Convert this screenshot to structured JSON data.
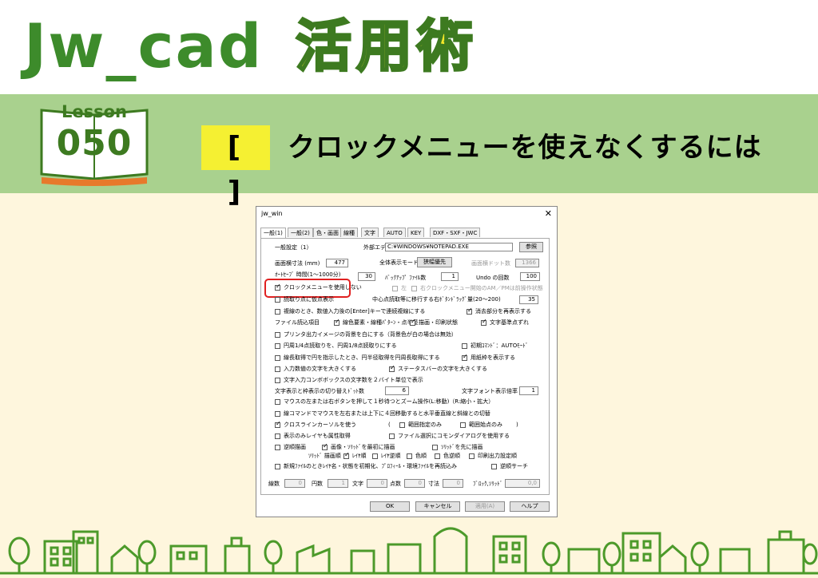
{
  "header": {
    "logo_latin": "Jw_cad",
    "logo_kanji": "活用術"
  },
  "lesson": {
    "label": "Lesson",
    "number": "050",
    "bracket": "[ ]",
    "title": "クロックメニューを使えなくするには"
  },
  "dialog": {
    "title": "jw_win",
    "close": "✕",
    "tabs": [
      "一般(1)",
      "一般(2)",
      "色・画面",
      "線種",
      "文字",
      "AUTO",
      "KEY",
      "DXF・SXF・JWC"
    ],
    "section": "一般設定（1）",
    "ext_editor_label": "外部エディタ",
    "ext_editor_value": "C:¥WINDOWS¥NOTEPAD.EXE",
    "browse": "参照",
    "screen_width_label": "画面横寸法 (mm)",
    "screen_width": "477",
    "full_display_label": "全体表示モード",
    "full_display_btn": "狭幅優先",
    "screen_dots_label": "画面横ドット数",
    "screen_dots": "1366",
    "autosave_label": "ｵｰﾄｾｰﾌﾞ 時間(1～1000分)",
    "autosave": "30",
    "backup_label": "ﾊﾞｯｸｱｯﾌﾟ ﾌｧｲﾙ数",
    "backup": "1",
    "undo_label": "Undo の回数",
    "undo": "100",
    "clock_label": "クロックメニューを使用しない",
    "left_label": "左",
    "right_clock_label": "右クロックメニュー開始のAM／PMは前操作状態",
    "read_point_label": "読取り点に仮点表示",
    "center_label": "中心点読取等に移行する右ﾎﾞﾀﾝﾄﾞﾗｯｸﾞ量(20～200)",
    "center_value": "35",
    "opt1": "複線のとき、数値入力後の[Enter]キーで連続複線にする",
    "opt1r": "消去部分を再表示する",
    "file_read_label": "ファイル読込項目",
    "file_read_a": "線色要素・線種ﾊﾟﾀｰﾝ・点半径",
    "file_read_b": "描画・印刷状態",
    "file_read_c": "文字基準点ずれ",
    "opt2": "プリンタ出力イメージの背景を白にする（背景色が白の場合は無効）",
    "opt3": "円周1/4点読取りを、円周1/8点読取りにする",
    "opt3r": "初期ｺﾏﾝﾄﾞ：AUTOﾓｰﾄﾞ",
    "opt4": "線長取得で円を指示したとき、円半径取得を円周長取得にする",
    "opt4r": "用紙枠を表示する",
    "opt5": "入力数値の文字を大きくする",
    "opt5r": "ステータスバーの文字を大きくする",
    "opt6": "文字入力コンボボックスの文字数を２バイト単位で表示",
    "text_dots_label": "文字表示と枠表示の切り替えﾄﾞｯﾄ数",
    "text_dots": "6",
    "text_font_label": "文字フォント表示倍率",
    "text_font": "1",
    "opt7": "マウスの左または右ボタンを押して１秒待つとズーム操作(L:移動)（R:縮小・拡大）",
    "opt8": "線コマンドでマウスを左右または上下に４回移動すると水平垂直線と斜線との切替",
    "opt9": "クロスラインカーソルを使う",
    "opt9a": "範囲指定のみ",
    "opt9b": "範囲始点のみ",
    "paren_open": "(",
    "paren_close": ")",
    "opt10": "表示のみレイヤも属性取得",
    "opt10r": "ファイル選択にコモンダイアログを使用する",
    "opt11": "逆順描画",
    "opt11a": "画像・ｿﾘｯﾄﾞを最初に描画",
    "opt11b": "ｿﾘｯﾄﾞを先に描画",
    "solid_label": "ｿﾘｯﾄﾞ 描画順",
    "layer_order": "ﾚｲﾔ順",
    "layer_rev": "ﾚｲﾔ逆順",
    "color_order": "色順",
    "color_rev": "色逆順",
    "print_order": "印刷出力設定順",
    "opt12": "新規ﾌｧｲﾙのときﾚｲﾔ名・状態を初期化、ﾌﾟﾛﾌｨｰﾙ・環境ﾌｧｲﾙを再読込み",
    "opt12r": "逆順サーチ",
    "counts": [
      {
        "label": "線数",
        "value": "0"
      },
      {
        "label": "円数",
        "value": "1"
      },
      {
        "label": "文字",
        "value": "0"
      },
      {
        "label": "点数",
        "value": "0"
      },
      {
        "label": "寸法",
        "value": "0"
      },
      {
        "label": "ﾌﾞﾛｯｸ,ｿﾘｯﾄﾞ",
        "value": "0,0"
      }
    ],
    "ok": "OK",
    "cancel": "キャンセル",
    "apply": "適用(A)",
    "help": "ヘルプ"
  }
}
